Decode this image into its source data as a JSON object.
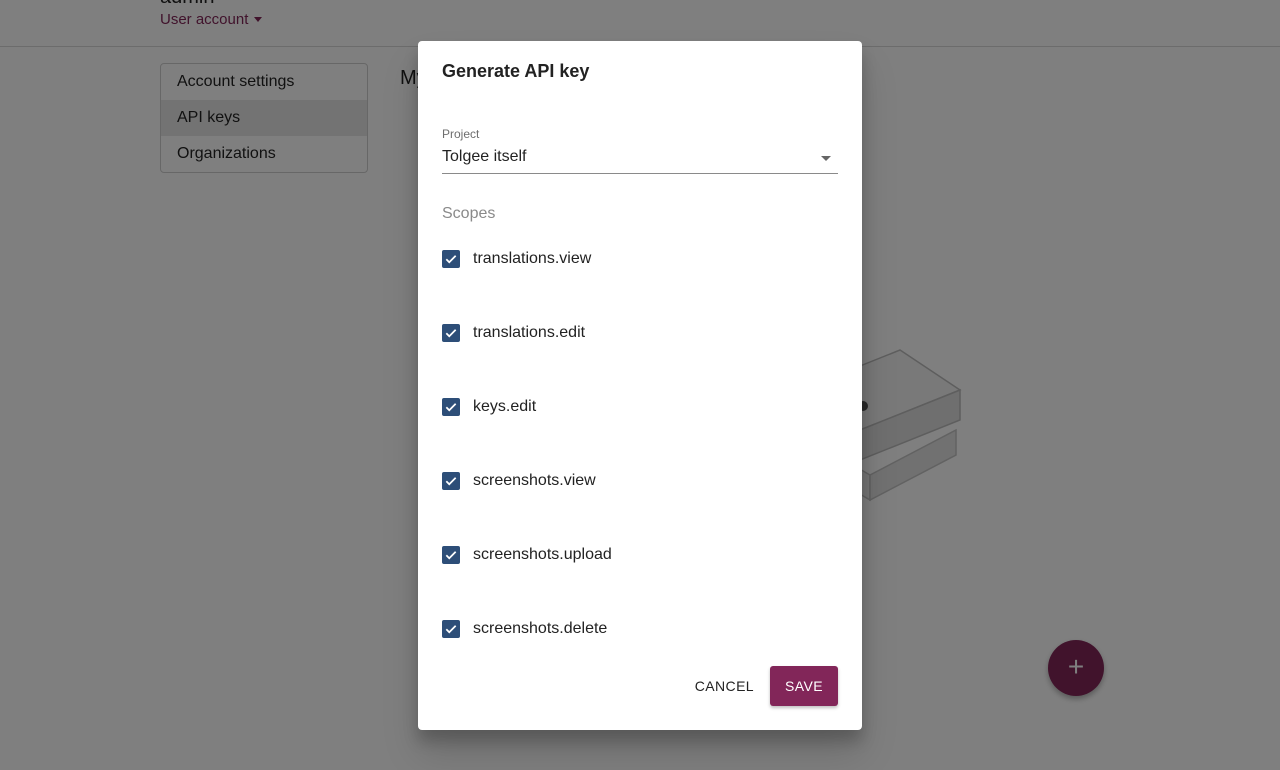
{
  "header": {
    "user_name": "admin",
    "user_menu_label": "User account"
  },
  "sidebar": {
    "items": [
      {
        "label": "Account settings"
      },
      {
        "label": "API keys"
      },
      {
        "label": "Organizations"
      }
    ]
  },
  "main": {
    "title": "My API keys"
  },
  "dialog": {
    "title": "Generate API key",
    "project": {
      "label": "Project",
      "value": "Tolgee itself"
    },
    "scopes_label": "Scopes",
    "scopes": [
      {
        "label": "translations.view",
        "checked": true
      },
      {
        "label": "translations.edit",
        "checked": true
      },
      {
        "label": "keys.edit",
        "checked": true
      },
      {
        "label": "screenshots.view",
        "checked": true
      },
      {
        "label": "screenshots.upload",
        "checked": true
      },
      {
        "label": "screenshots.delete",
        "checked": true
      }
    ],
    "cancel_label": "CANCEL",
    "save_label": "SAVE"
  },
  "fab": {
    "icon": "plus-icon",
    "symbol": "+"
  },
  "colors": {
    "accent": "#822659",
    "checkbox": "#2d4e78"
  }
}
